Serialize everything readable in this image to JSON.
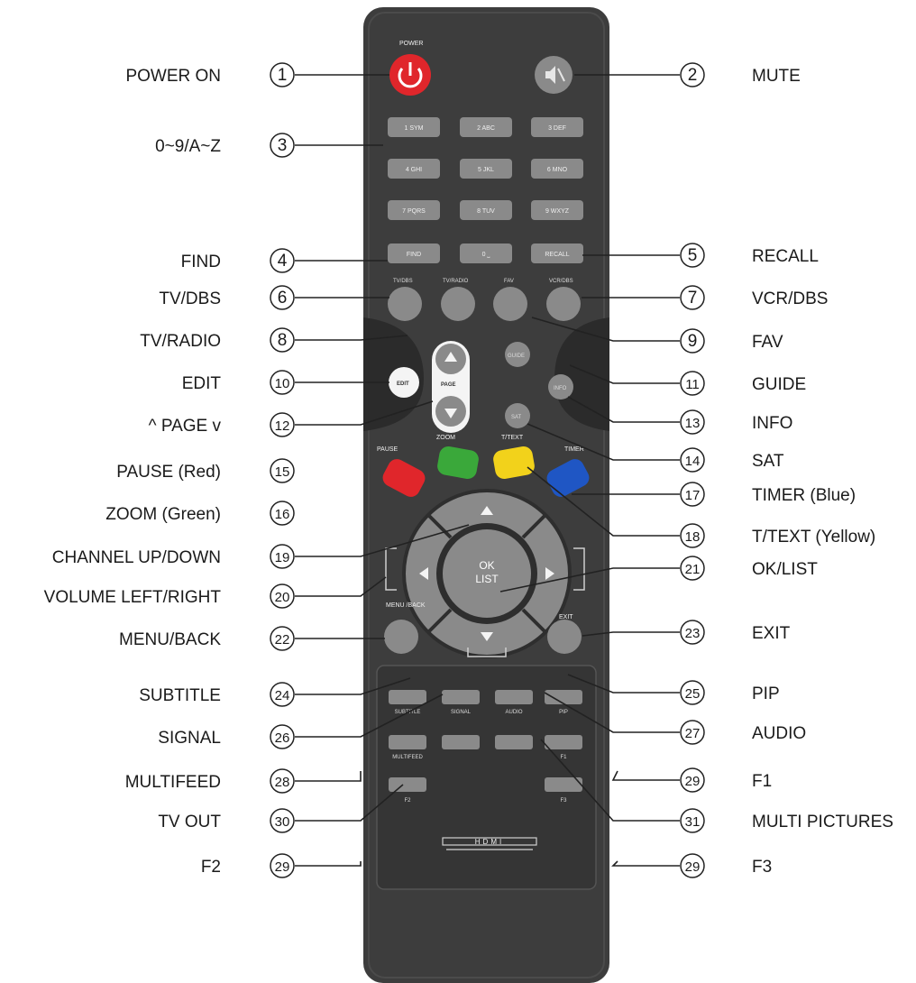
{
  "callouts": {
    "power_on": {
      "num": "1",
      "label": "POWER ON"
    },
    "mute": {
      "num": "2",
      "label": "MUTE"
    },
    "alnum": {
      "num": "3",
      "label": "0~9/A~Z"
    },
    "find": {
      "num": "4",
      "label": "FIND"
    },
    "recall": {
      "num": "5",
      "label": "RECALL"
    },
    "tv_dbs": {
      "num": "6",
      "label": "TV/DBS"
    },
    "vcr_dbs": {
      "num": "7",
      "label": "VCR/DBS"
    },
    "tv_radio": {
      "num": "8",
      "label": "TV/RADIO"
    },
    "fav": {
      "num": "9",
      "label": "FAV"
    },
    "edit": {
      "num": "10",
      "label": "EDIT"
    },
    "guide": {
      "num": "11",
      "label": "GUIDE"
    },
    "page": {
      "num": "12",
      "label": "^ PAGE v"
    },
    "info": {
      "num": "13",
      "label": "INFO"
    },
    "sat": {
      "num": "14",
      "label": "SAT"
    },
    "pause": {
      "num": "15",
      "label": "PAUSE (Red)"
    },
    "zoom": {
      "num": "16",
      "label": "ZOOM (Green)"
    },
    "timer": {
      "num": "17",
      "label": "TIMER (Blue)"
    },
    "ttext": {
      "num": "18",
      "label": "T/TEXT (Yellow)"
    },
    "channel": {
      "num": "19",
      "label": "CHANNEL UP/DOWN"
    },
    "volume": {
      "num": "20",
      "label": "VOLUME LEFT/RIGHT"
    },
    "oklist": {
      "num": "21",
      "label": "OK/LIST"
    },
    "menu_back": {
      "num": "22",
      "label": "MENU/BACK"
    },
    "exit": {
      "num": "23",
      "label": "EXIT"
    },
    "subtitle": {
      "num": "24",
      "label": "SUBTITLE"
    },
    "pip": {
      "num": "25",
      "label": "PIP"
    },
    "signal": {
      "num": "26",
      "label": "SIGNAL"
    },
    "audio": {
      "num": "27",
      "label": "AUDIO"
    },
    "multifeed": {
      "num": "28",
      "label": "MULTIFEED"
    },
    "f1": {
      "num": "29",
      "label": "F1"
    },
    "tv_out": {
      "num": "30",
      "label": "TV OUT"
    },
    "multi_pictures": {
      "num": "31",
      "label": "MULTI PICTURES"
    },
    "f2": {
      "num": "29",
      "label": "F2"
    },
    "f3": {
      "num": "29",
      "label": "F3"
    }
  },
  "remote": {
    "power_caption": "POWER",
    "keys_row1": [
      "1 SYM",
      "2 ABC",
      "3 DEF"
    ],
    "keys_row2": [
      "4 GHI",
      "5 JKL",
      "6 MNO"
    ],
    "keys_row3": [
      "7 PQRS",
      "8 TUV",
      "9 WXYZ"
    ],
    "keys_row4": [
      "FIND",
      "0 ⎵",
      "RECALL"
    ],
    "func_captions": [
      "TV/DBS",
      "TV/RADIO",
      "FAV",
      "VCR/DBS"
    ],
    "guide_key": "GUIDE",
    "edit_key": "EDIT",
    "page_key": "PAGE",
    "info_key": "INFO",
    "sat_key": "SAT",
    "color_captions": [
      "PAUSE",
      "ZOOM",
      "T/TEXT",
      "TIMER"
    ],
    "ok_line1": "OK",
    "ok_line2": "LIST",
    "menu_caption": "MENU /BACK",
    "exit_caption": "EXIT",
    "bottom_captions": [
      "SUBTITLE",
      "SIGNAL",
      "AUDIO",
      "PIP"
    ],
    "bottom_captions2": [
      "MULTIFEED",
      "",
      "",
      "F1"
    ],
    "f_captions": [
      "F2",
      "F3"
    ],
    "brand": "HDMI"
  },
  "colors": {
    "body": "#3d3d3d",
    "button": "#8a8a8a",
    "power": "#e0262b",
    "red": "#e0262b",
    "green": "#3aa83a",
    "yellow": "#f2d21b",
    "blue": "#1f56c4"
  }
}
